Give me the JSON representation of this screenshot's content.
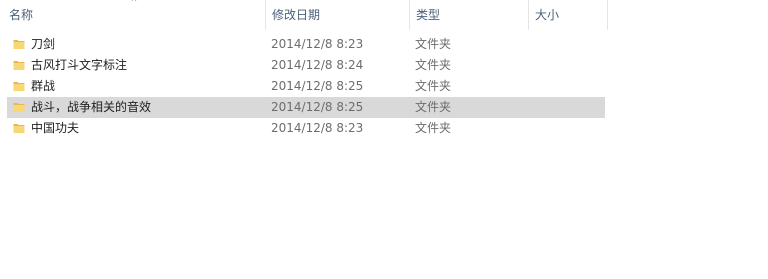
{
  "header": {
    "name": "名称",
    "date": "修改日期",
    "type": "类型",
    "size": "大小"
  },
  "rows": [
    {
      "name": "刀剑",
      "date": "2014/12/8 8:23",
      "type": "文件夹",
      "selected": false
    },
    {
      "name": "古风打斗文字标注",
      "date": "2014/12/8 8:24",
      "type": "文件夹",
      "selected": false
    },
    {
      "name": "群战",
      "date": "2014/12/8 8:25",
      "type": "文件夹",
      "selected": false
    },
    {
      "name": "战斗，战争相关的音效",
      "date": "2014/12/8 8:25",
      "type": "文件夹",
      "selected": true
    },
    {
      "name": "中国功夫",
      "date": "2014/12/8 8:23",
      "type": "文件夹",
      "selected": false
    }
  ],
  "colors": {
    "folder_front": "#f8d775",
    "folder_back": "#e8b94a",
    "selection": "#d9d9d9"
  }
}
